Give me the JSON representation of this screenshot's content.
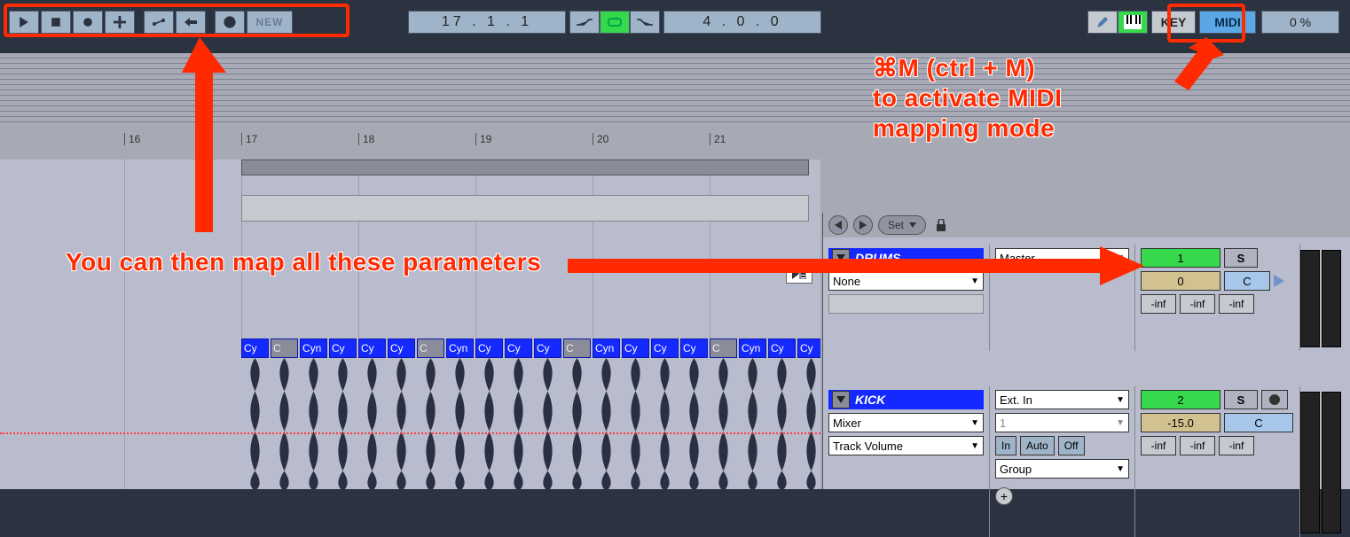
{
  "toolbar": {
    "play": "▶",
    "stop": "■",
    "record": "●",
    "plus": "＋",
    "automation_arm": "⟶",
    "back": "←",
    "session_record": "○",
    "new_label": "NEW",
    "position": "17 .  1 .  1",
    "punch_in": "↘",
    "loop": "↻",
    "punch_out": "↗",
    "loop_length": "4 .  0 .  0",
    "pencil": "✎",
    "key_label": "KEY",
    "midi_label": "MIDI",
    "cpu_pct": "0 %"
  },
  "ruler": {
    "marks": [
      "16",
      "17",
      "18",
      "19",
      "20",
      "21"
    ]
  },
  "nav": {
    "set_label": "Set"
  },
  "tracks": {
    "drums": {
      "name": "DRUMS",
      "routing1": "Master",
      "routing2": "None",
      "num1": "1",
      "num2": "0",
      "pan": "C",
      "solo": "S",
      "inf": "-inf"
    },
    "kick": {
      "name": "KICK",
      "routing1": "Ext. In",
      "routing2": "Mixer",
      "routing2b": "1",
      "routing3": "Track Volume",
      "monitor_in": "In",
      "monitor_auto": "Auto",
      "monitor_off": "Off",
      "group": "Group",
      "num1": "2",
      "gain": "-15.0",
      "pan": "C",
      "solo": "S",
      "inf": "-inf"
    }
  },
  "clips": {
    "labels": [
      "Cy",
      "C",
      "Cyn",
      "Cy",
      "Cy",
      "Cy",
      "C",
      "Cyn",
      "Cy",
      "Cy",
      "Cy",
      "C",
      "Cyn",
      "Cy",
      "Cy",
      "Cy",
      "C",
      "Cyn",
      "Cy",
      "Cy"
    ]
  },
  "annotations": {
    "midi_help": "⌘M (ctrl + M)\nto activate MIDI\nmapping mode",
    "map_help": "You can then map all these parameters"
  }
}
